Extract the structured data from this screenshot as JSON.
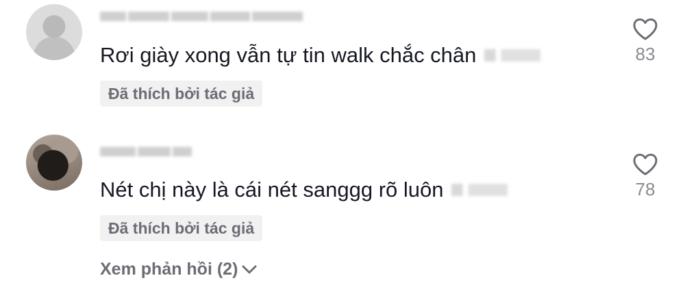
{
  "comments": [
    {
      "username_visibility": "blurred",
      "text": "Rơi giày xong vẫn tự tin walk chắc chân",
      "timestamp_visibility": "blurred",
      "liked_badge": "Đã thích bởi tác giả",
      "like_count": "83",
      "heart_icon": "heart-outline-icon"
    },
    {
      "username_visibility": "blurred",
      "text": "Nét chị này là cái nét sanggg rõ luôn",
      "timestamp_visibility": "blurred",
      "liked_badge": "Đã thích bởi tác giả",
      "like_count": "78",
      "heart_icon": "heart-outline-icon"
    }
  ],
  "view_replies": {
    "label": "Xem phản hồi (2)",
    "icon": "chevron-down-icon"
  },
  "colors": {
    "text_primary": "#161823",
    "text_secondary": "#6c6d74",
    "count_gray": "#8a8b91",
    "badge_bg": "#f1f1f2"
  }
}
